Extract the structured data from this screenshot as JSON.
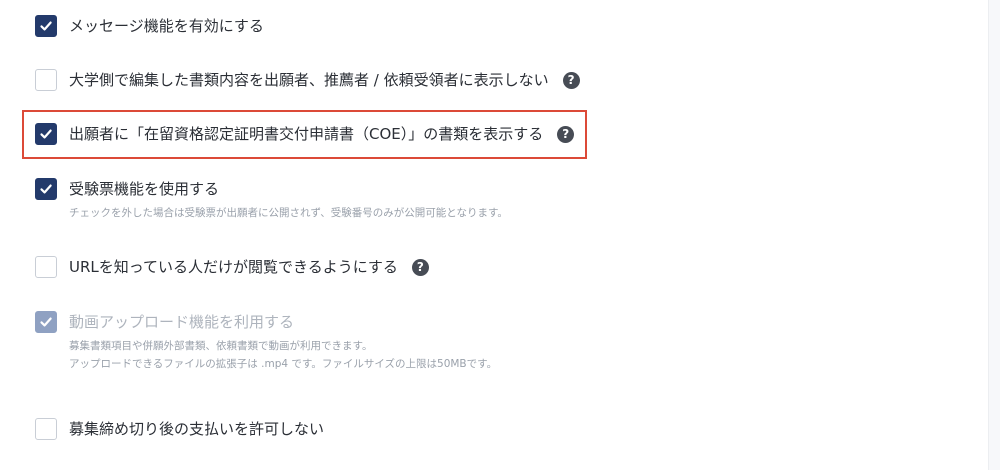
{
  "options": [
    {
      "label": "メッセージ機能を有効にする",
      "state": "checked",
      "help": false
    },
    {
      "label": "大学側で編集した書類内容を出願者、推薦者 / 依頼受領者に表示しない",
      "state": "unchecked",
      "help": true
    },
    {
      "label": "出願者に「在留資格認定証明書交付申請書（COE）」の書類を表示する",
      "state": "checked",
      "help": true
    },
    {
      "label": "受験票機能を使用する",
      "state": "checked",
      "help": false,
      "description": "チェックを外した場合は受験票が出願者に公開されず、受験番号のみが公開可能となります。"
    },
    {
      "label": "URLを知っている人だけが閲覧できるようにする",
      "state": "unchecked",
      "help": true
    },
    {
      "label": "動画アップロード機能を利用する",
      "state": "checked-disabled",
      "help": false,
      "description_lines": [
        "募集書類項目や併願外部書類、依頼書類で動画が利用できます。",
        "アップロードできるファイルの拡張子は .mp4 です。ファイルサイズの上限は50MBです。"
      ]
    },
    {
      "label": "募集締め切り後の支払いを許可しない",
      "state": "unchecked",
      "help": false
    }
  ],
  "help_glyph": "?",
  "icons": {
    "checkbox_checked": "checkmark-icon",
    "help": "question-circle-icon"
  },
  "colors": {
    "checked": "#233a6b",
    "disabled_checked": "#8fa1c2",
    "highlight": "#dc4a38",
    "help_icon": "#474c55"
  }
}
